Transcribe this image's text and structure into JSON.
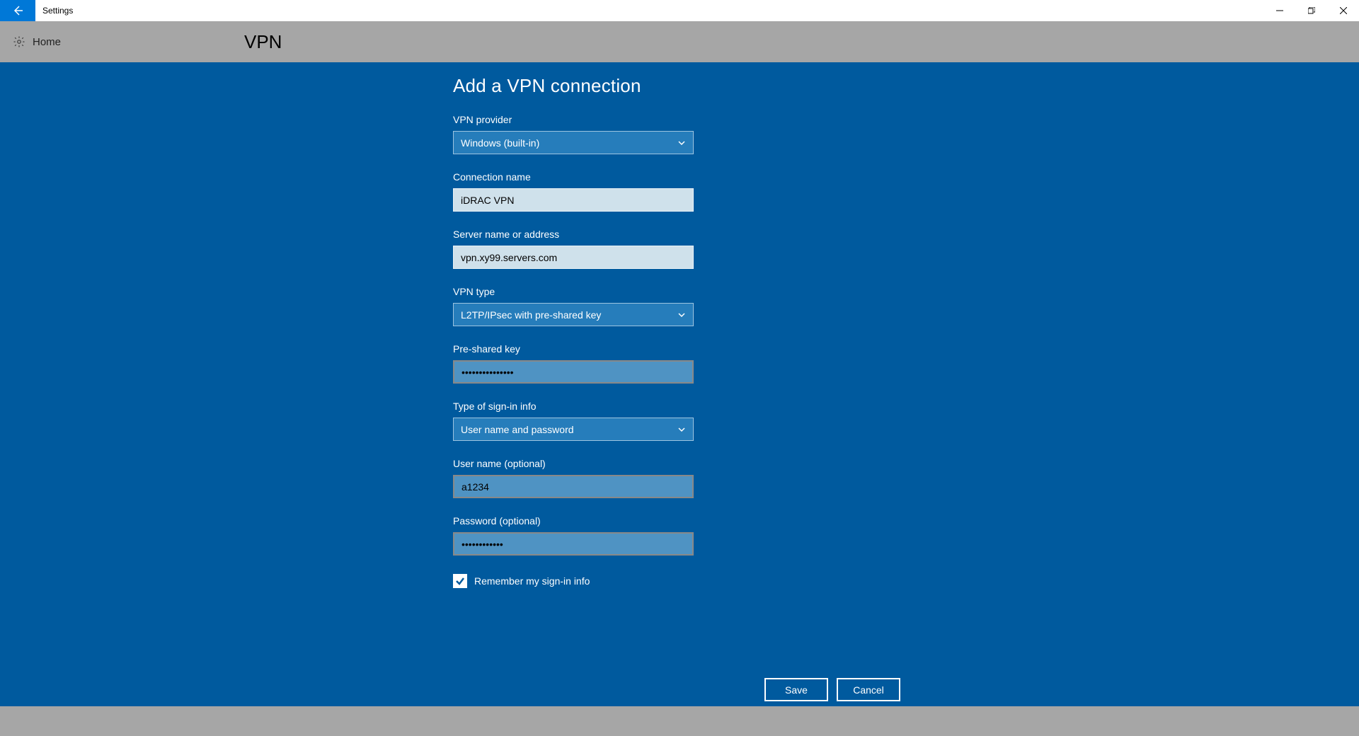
{
  "titlebar": {
    "app_name": "Settings"
  },
  "header": {
    "home_label": "Home",
    "page_title": "VPN"
  },
  "dialog": {
    "title": "Add a VPN connection",
    "fields": {
      "provider": {
        "label": "VPN provider",
        "value": "Windows (built-in)"
      },
      "name": {
        "label": "Connection name",
        "value": "iDRAC VPN"
      },
      "server": {
        "label": "Server name or address",
        "value": "vpn.xy99.servers.com"
      },
      "type": {
        "label": "VPN type",
        "value": "L2TP/IPsec with pre-shared key"
      },
      "psk": {
        "label": "Pre-shared key",
        "value": "•••••••••••••••"
      },
      "signin": {
        "label": "Type of sign-in info",
        "value": "User name and password"
      },
      "user": {
        "label": "User name (optional)",
        "value": "a1234"
      },
      "pass": {
        "label": "Password (optional)",
        "value": "••••••••••••"
      }
    },
    "remember": {
      "label": "Remember my sign-in info",
      "checked": true
    },
    "buttons": {
      "save": "Save",
      "cancel": "Cancel"
    }
  }
}
